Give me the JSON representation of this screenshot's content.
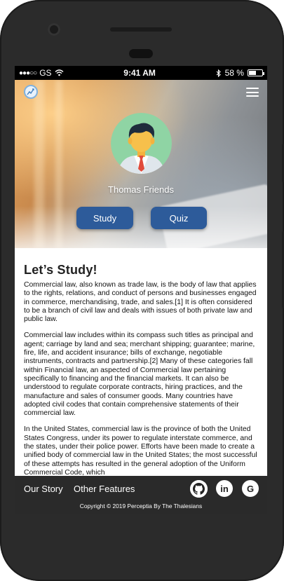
{
  "status_bar": {
    "carrier": "GS",
    "time": "9:41 AM",
    "battery_percent": "58 %",
    "battery_level": 0.58
  },
  "header": {
    "logo_icon": "logo-icon",
    "menu_icon": "hamburger-menu-icon"
  },
  "profile": {
    "name": "Thomas Friends",
    "avatar_icon": "user-avatar-icon"
  },
  "actions": {
    "study_label": "Study",
    "quiz_label": "Quiz",
    "button_color": "#2d5b9a"
  },
  "content": {
    "title": "Let’s Study!",
    "paragraphs": [
      "Commercial law, also known as trade law, is the body of law that applies to the rights, relations, and conduct of persons and businesses engaged in commerce, merchandising, trade, and sales.[1] It is often considered to be a branch of civil law and deals with issues of both private law and public law.",
      "Commercial law includes within its compass such titles as principal and agent; carriage by land and sea; merchant shipping; guarantee; marine, fire, life, and accident insurance; bills of exchange, negotiable instruments, contracts and partnership.[2] Many of these categories fall within Financial law, an aspected of Commercial law pertaining specifically to financing and the financial markets. It can also be understood to regulate corporate contracts, hiring practices, and the manufacture and sales of consumer goods. Many countries have adopted civil codes that contain comprehensive statements of their commercial law.",
      "In the United States, commercial law is the province of both the United States Congress, under its power to regulate interstate commerce, and the states, under their police power. Efforts have been made to create a unified body of commercial law in the United States; the most successful of these attempts has resulted in the general adoption of the Uniform Commercial Code, which"
    ]
  },
  "footer": {
    "links": [
      "Our Story",
      "Other Features"
    ],
    "social_icons": [
      "github-icon",
      "linkedin-icon",
      "google-icon"
    ],
    "copyright": "Copyright © 2019 Perceptia By The Thalesians"
  }
}
